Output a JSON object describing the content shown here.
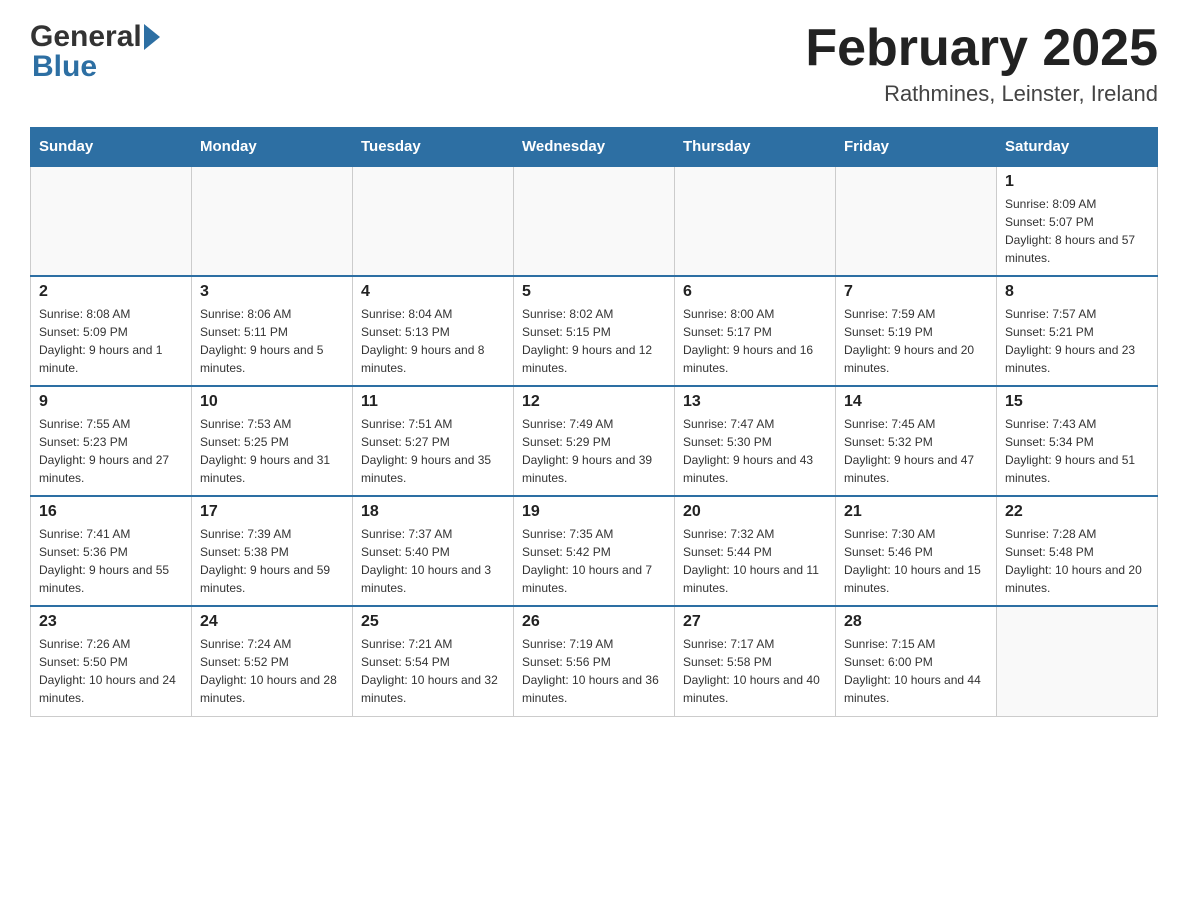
{
  "header": {
    "logo_general": "General",
    "logo_blue": "Blue",
    "month_title": "February 2025",
    "location": "Rathmines, Leinster, Ireland"
  },
  "days_of_week": [
    "Sunday",
    "Monday",
    "Tuesday",
    "Wednesday",
    "Thursday",
    "Friday",
    "Saturday"
  ],
  "weeks": [
    [
      {
        "day": "",
        "info": ""
      },
      {
        "day": "",
        "info": ""
      },
      {
        "day": "",
        "info": ""
      },
      {
        "day": "",
        "info": ""
      },
      {
        "day": "",
        "info": ""
      },
      {
        "day": "",
        "info": ""
      },
      {
        "day": "1",
        "info": "Sunrise: 8:09 AM\nSunset: 5:07 PM\nDaylight: 8 hours and 57 minutes."
      }
    ],
    [
      {
        "day": "2",
        "info": "Sunrise: 8:08 AM\nSunset: 5:09 PM\nDaylight: 9 hours and 1 minute."
      },
      {
        "day": "3",
        "info": "Sunrise: 8:06 AM\nSunset: 5:11 PM\nDaylight: 9 hours and 5 minutes."
      },
      {
        "day": "4",
        "info": "Sunrise: 8:04 AM\nSunset: 5:13 PM\nDaylight: 9 hours and 8 minutes."
      },
      {
        "day": "5",
        "info": "Sunrise: 8:02 AM\nSunset: 5:15 PM\nDaylight: 9 hours and 12 minutes."
      },
      {
        "day": "6",
        "info": "Sunrise: 8:00 AM\nSunset: 5:17 PM\nDaylight: 9 hours and 16 minutes."
      },
      {
        "day": "7",
        "info": "Sunrise: 7:59 AM\nSunset: 5:19 PM\nDaylight: 9 hours and 20 minutes."
      },
      {
        "day": "8",
        "info": "Sunrise: 7:57 AM\nSunset: 5:21 PM\nDaylight: 9 hours and 23 minutes."
      }
    ],
    [
      {
        "day": "9",
        "info": "Sunrise: 7:55 AM\nSunset: 5:23 PM\nDaylight: 9 hours and 27 minutes."
      },
      {
        "day": "10",
        "info": "Sunrise: 7:53 AM\nSunset: 5:25 PM\nDaylight: 9 hours and 31 minutes."
      },
      {
        "day": "11",
        "info": "Sunrise: 7:51 AM\nSunset: 5:27 PM\nDaylight: 9 hours and 35 minutes."
      },
      {
        "day": "12",
        "info": "Sunrise: 7:49 AM\nSunset: 5:29 PM\nDaylight: 9 hours and 39 minutes."
      },
      {
        "day": "13",
        "info": "Sunrise: 7:47 AM\nSunset: 5:30 PM\nDaylight: 9 hours and 43 minutes."
      },
      {
        "day": "14",
        "info": "Sunrise: 7:45 AM\nSunset: 5:32 PM\nDaylight: 9 hours and 47 minutes."
      },
      {
        "day": "15",
        "info": "Sunrise: 7:43 AM\nSunset: 5:34 PM\nDaylight: 9 hours and 51 minutes."
      }
    ],
    [
      {
        "day": "16",
        "info": "Sunrise: 7:41 AM\nSunset: 5:36 PM\nDaylight: 9 hours and 55 minutes."
      },
      {
        "day": "17",
        "info": "Sunrise: 7:39 AM\nSunset: 5:38 PM\nDaylight: 9 hours and 59 minutes."
      },
      {
        "day": "18",
        "info": "Sunrise: 7:37 AM\nSunset: 5:40 PM\nDaylight: 10 hours and 3 minutes."
      },
      {
        "day": "19",
        "info": "Sunrise: 7:35 AM\nSunset: 5:42 PM\nDaylight: 10 hours and 7 minutes."
      },
      {
        "day": "20",
        "info": "Sunrise: 7:32 AM\nSunset: 5:44 PM\nDaylight: 10 hours and 11 minutes."
      },
      {
        "day": "21",
        "info": "Sunrise: 7:30 AM\nSunset: 5:46 PM\nDaylight: 10 hours and 15 minutes."
      },
      {
        "day": "22",
        "info": "Sunrise: 7:28 AM\nSunset: 5:48 PM\nDaylight: 10 hours and 20 minutes."
      }
    ],
    [
      {
        "day": "23",
        "info": "Sunrise: 7:26 AM\nSunset: 5:50 PM\nDaylight: 10 hours and 24 minutes."
      },
      {
        "day": "24",
        "info": "Sunrise: 7:24 AM\nSunset: 5:52 PM\nDaylight: 10 hours and 28 minutes."
      },
      {
        "day": "25",
        "info": "Sunrise: 7:21 AM\nSunset: 5:54 PM\nDaylight: 10 hours and 32 minutes."
      },
      {
        "day": "26",
        "info": "Sunrise: 7:19 AM\nSunset: 5:56 PM\nDaylight: 10 hours and 36 minutes."
      },
      {
        "day": "27",
        "info": "Sunrise: 7:17 AM\nSunset: 5:58 PM\nDaylight: 10 hours and 40 minutes."
      },
      {
        "day": "28",
        "info": "Sunrise: 7:15 AM\nSunset: 6:00 PM\nDaylight: 10 hours and 44 minutes."
      },
      {
        "day": "",
        "info": ""
      }
    ]
  ]
}
